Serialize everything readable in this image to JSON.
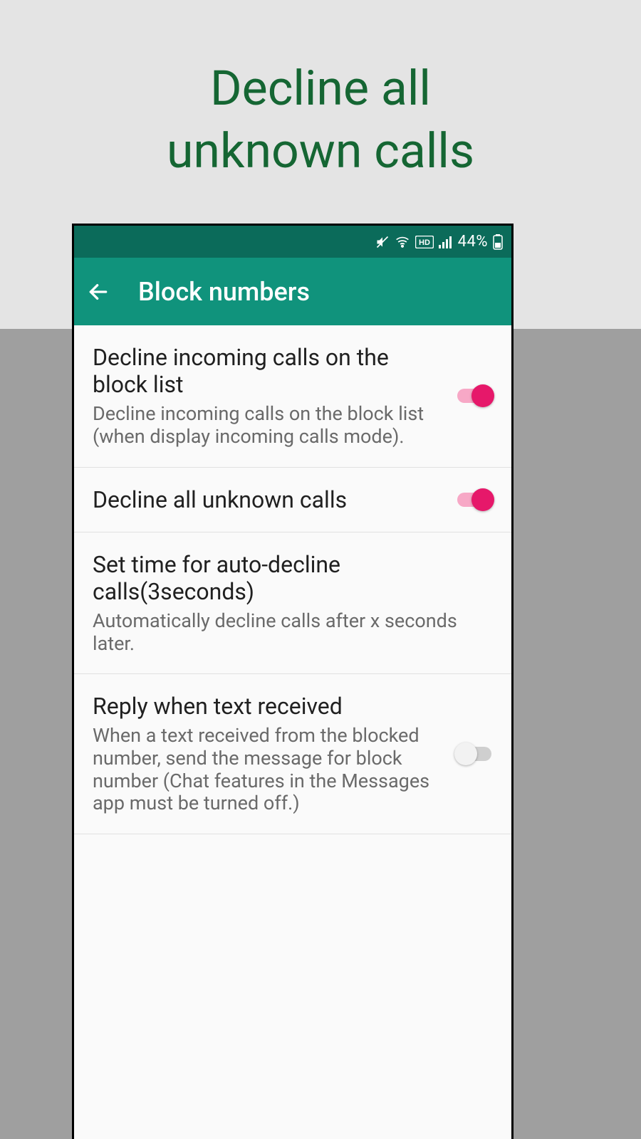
{
  "promo": {
    "line1": "Decline all",
    "line2": "unknown calls"
  },
  "statusbar": {
    "battery_text": "44%"
  },
  "appbar": {
    "title": "Block numbers"
  },
  "settings": [
    {
      "title": "Decline incoming calls on the block list",
      "subtitle": "Decline incoming calls on the block list (when display incoming calls mode).",
      "toggle": "on"
    },
    {
      "title": "Decline all unknown calls",
      "subtitle": "",
      "toggle": "on"
    },
    {
      "title": "Set time for auto-decline calls(3seconds)",
      "subtitle": "Automatically decline calls after x seconds later.",
      "toggle": null
    },
    {
      "title": "Reply when text received",
      "subtitle": "When a text received from the blocked number, send the message for block number (Chat features in the Messages app must be turned off.)",
      "toggle": "off"
    }
  ]
}
